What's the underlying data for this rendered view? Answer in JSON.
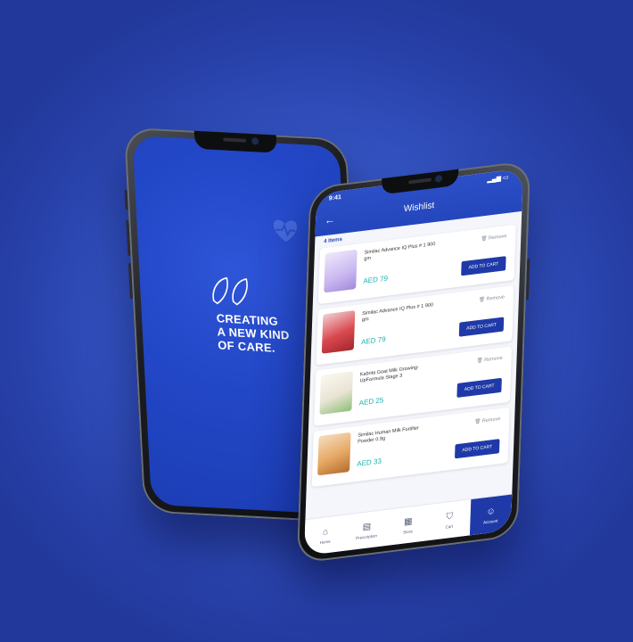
{
  "splash": {
    "tagline_lines": [
      "CREATING",
      "A NEW KIND",
      "OF CARE."
    ]
  },
  "wishlist": {
    "status_time": "9:41",
    "title": "Wishlist",
    "items_count": "4 Items",
    "remove_label": "Remove",
    "add_to_cart_label": "ADD TO CART",
    "items": [
      {
        "name": "Similac Advance IQ Plus # 1 900 gm",
        "price": "AED 79",
        "thumb_color": "#c9b7f0"
      },
      {
        "name": "Similac Advance IQ Plus # 1 900 gm",
        "price": "AED 79",
        "thumb_color": "#d9494f"
      },
      {
        "name": "Kabrita Goat Milk Growing-UpFormula Stage 3",
        "price": "AED 25",
        "thumb_color": "#e9e4d4"
      },
      {
        "name": "Similac Human Milk Fortifier Powder 0.9g",
        "price": "AED 33",
        "thumb_color": "#e6a865"
      }
    ],
    "nav": [
      {
        "label": "Home",
        "icon": "home-icon",
        "glyph": "⌂"
      },
      {
        "label": "Prescription",
        "icon": "prescription-icon",
        "glyph": "▤"
      },
      {
        "label": "Store",
        "icon": "store-icon",
        "glyph": "▦"
      },
      {
        "label": "Cart",
        "icon": "cart-icon",
        "glyph": "⛉"
      },
      {
        "label": "Account",
        "icon": "account-icon",
        "glyph": "☺"
      }
    ]
  },
  "colors": {
    "brand_blue": "#2446bd",
    "price_teal": "#17b3b3",
    "button_blue": "#1f3aa8"
  }
}
